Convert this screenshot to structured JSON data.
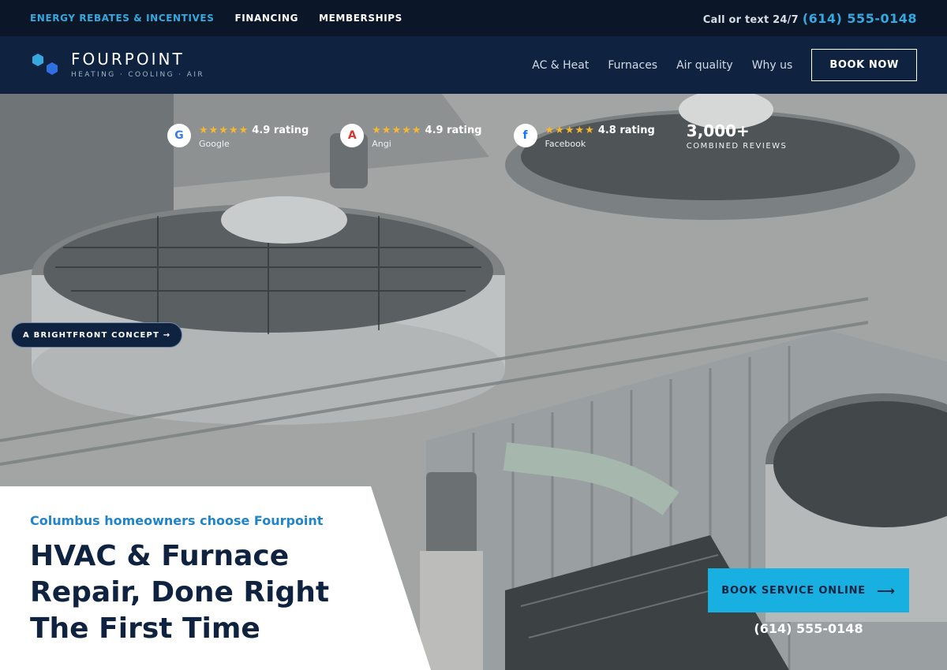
{
  "topbar": {
    "links": [
      {
        "label": "ENERGY REBATES & INCENTIVES"
      },
      {
        "label": "FINANCING"
      },
      {
        "label": "MEMBERSHIPS"
      }
    ],
    "call_label": "Call or text 24/7",
    "phone": "(614) 555-0148"
  },
  "header": {
    "brand": "FOURPOINT",
    "tagline": "HEATING · COOLING · AIR",
    "nav": [
      {
        "label": "AC & Heat"
      },
      {
        "label": "Furnaces"
      },
      {
        "label": "Air quality"
      },
      {
        "label": "Why us"
      }
    ],
    "book_label": "BOOK NOW"
  },
  "ratings": [
    {
      "badge": "G",
      "stars": "★★★★★",
      "value": "4.9 rating",
      "source": "Google"
    },
    {
      "badge": "A",
      "stars": "★★★★★",
      "value": "4.9 rating",
      "source": "Angi"
    },
    {
      "badge": "f",
      "stars": "★★★★★",
      "value": "4.8 rating",
      "source": "Facebook"
    }
  ],
  "combined": {
    "count": "3,000+",
    "label": "COMBINED REVIEWS"
  },
  "concept_pill": "A BRIGHTFRONT CONCEPT →",
  "hero": {
    "eyebrow": "Columbus homeowners choose Fourpoint",
    "headline": "HVAC & Furnace Repair, Done Right The First Time",
    "cta_label": "BOOK SERVICE ONLINE",
    "cta_arrow": "⟶",
    "phone": "(614) 555-0148"
  },
  "colors": {
    "navy": "#0f2340",
    "accent_blue": "#35a9de",
    "cta_blue": "#17b0e0",
    "star": "#f5b82e"
  },
  "icons": {
    "logo": "hexagon-cluster-icon",
    "arrow": "arrow-right-icon"
  }
}
